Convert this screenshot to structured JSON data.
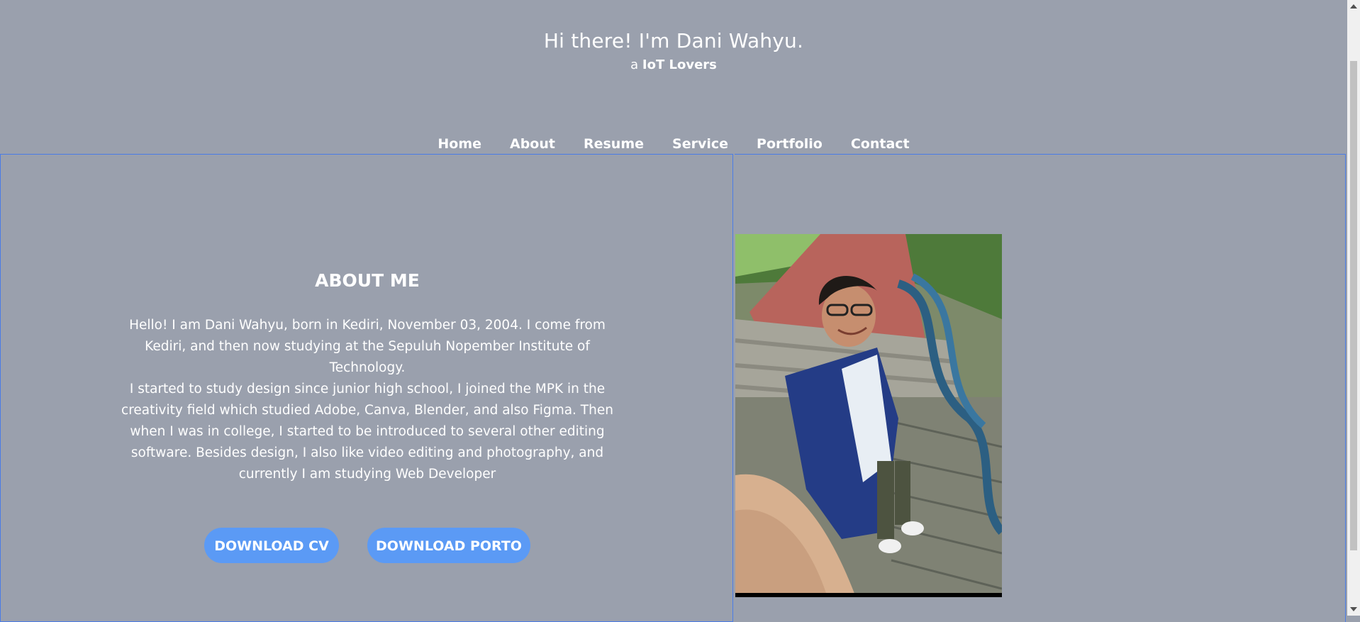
{
  "header": {
    "greeting": "Hi there! I'm Dani Wahyu.",
    "tagline_prefix": "a ",
    "tagline_strong": "IoT Lovers"
  },
  "nav": {
    "items": [
      {
        "label": "Home"
      },
      {
        "label": "About"
      },
      {
        "label": "Resume"
      },
      {
        "label": "Service"
      },
      {
        "label": "Portfolio"
      },
      {
        "label": "Contact"
      }
    ]
  },
  "about": {
    "title": "ABOUT ME",
    "paragraph1": "Hello! I am Dani Wahyu, born in Kediri, November 03, 2004. I come from Kediri, and then now studying at the Sepuluh Nopember Institute of Technology.",
    "paragraph2": "I started to study design since junior high school, I joined the MPK in the creativity field which studied Adobe, Canva, Blender, and also Figma. Then when I was in college, I started to be introduced to several other editing software. Besides design, I also like video editing and photography, and currently I am studying Web Developer",
    "buttons": {
      "cv": "DOWNLOAD CV",
      "porto": "DOWNLOAD PORTO"
    }
  },
  "colors": {
    "background": "#9aa0ad",
    "button": "#5b9af5",
    "border": "#4a7ce6"
  }
}
